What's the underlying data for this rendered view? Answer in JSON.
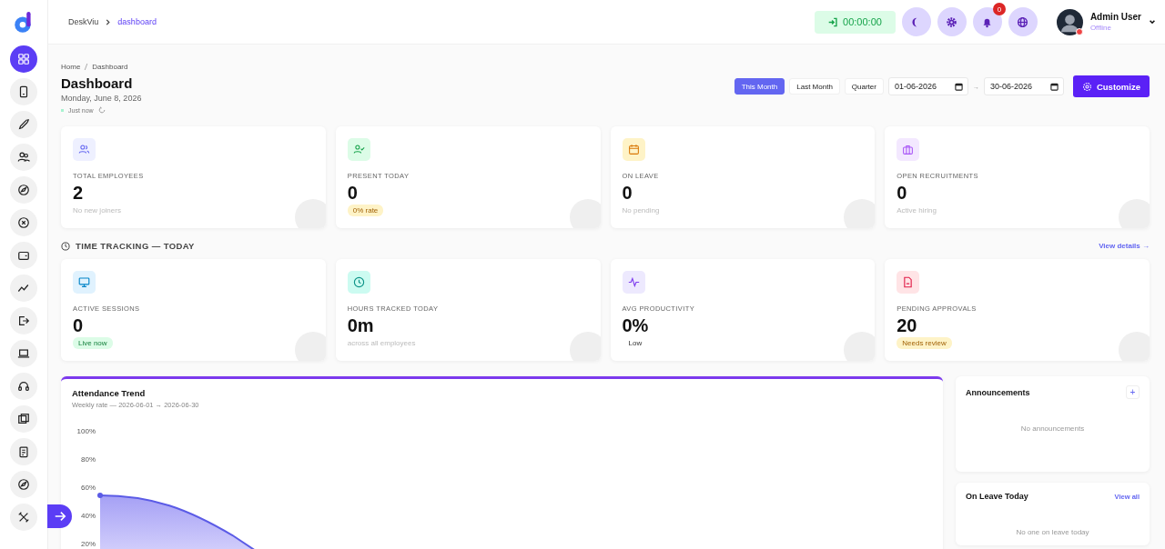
{
  "sidebar": {
    "items": [
      {
        "selected": true
      },
      {
        "selected": false
      },
      {
        "selected": false
      },
      {
        "selected": false
      },
      {
        "selected": false
      },
      {
        "selected": false
      },
      {
        "selected": false
      },
      {
        "selected": false
      },
      {
        "selected": false
      },
      {
        "selected": false
      },
      {
        "selected": false
      },
      {
        "selected": false
      },
      {
        "selected": false
      },
      {
        "selected": false
      },
      {
        "selected": false
      }
    ]
  },
  "topbar": {
    "breadcrumb": [
      "DeskViu",
      "dashboard"
    ],
    "timer": "00:00:00",
    "notifications": "0",
    "user": {
      "name": "Admin User",
      "status": "Offline"
    }
  },
  "page": {
    "breadcrumb": [
      "Home",
      "Dashboard"
    ],
    "title": "Dashboard",
    "date": "Monday, June 8, 2026",
    "updated": "Just now"
  },
  "filters": {
    "options": [
      {
        "label": "This Month",
        "selected": true
      },
      {
        "label": "Last Month",
        "selected": false
      },
      {
        "label": "Quarter",
        "selected": false
      }
    ],
    "from": "01-06-2026",
    "separator": "→",
    "to": "30-06-2026",
    "customize": "Customize"
  },
  "stats": [
    {
      "label": "TOTAL EMPLOYEES",
      "value": "2",
      "note": {
        "text": "No new joiners",
        "kind": "text"
      }
    },
    {
      "label": "PRESENT TODAY",
      "value": "0",
      "note": {
        "text": "0% rate",
        "kind": "warning"
      }
    },
    {
      "label": "ON LEAVE",
      "value": "0",
      "note": {
        "text": "No pending",
        "kind": "text"
      }
    },
    {
      "label": "OPEN RECRUITMENTS",
      "value": "0",
      "note": {
        "text": "Active hiring",
        "kind": "text"
      }
    }
  ],
  "time_tracking": {
    "title": "TIME TRACKING — TODAY",
    "link": "View details →",
    "stats": [
      {
        "label": "ACTIVE SESSIONS",
        "value": "0",
        "note": {
          "text": "Live now",
          "kind": "success"
        }
      },
      {
        "label": "HOURS TRACKED TODAY",
        "value": "0m",
        "note": {
          "text": "across all employees",
          "kind": "text"
        }
      },
      {
        "label": "AVG PRODUCTIVITY",
        "value": "0%",
        "note": {
          "text": "Low",
          "kind": "plain"
        }
      },
      {
        "label": "PENDING APPROVALS",
        "value": "20",
        "note": {
          "text": "Needs review",
          "kind": "warning"
        }
      }
    ]
  },
  "attendance": {
    "title": "Attendance Trend",
    "subtitle": "Weekly rate — 2026-06-01 → 2026-06-30",
    "y_axis_labels": [
      "100%",
      "80%",
      "60%",
      "40%",
      "20%"
    ]
  },
  "announcements": {
    "title": "Announcements",
    "add": "+",
    "empty": "No announcements"
  },
  "on_leave": {
    "title": "On Leave Today",
    "link": "View all",
    "empty": "No one on leave today"
  }
}
